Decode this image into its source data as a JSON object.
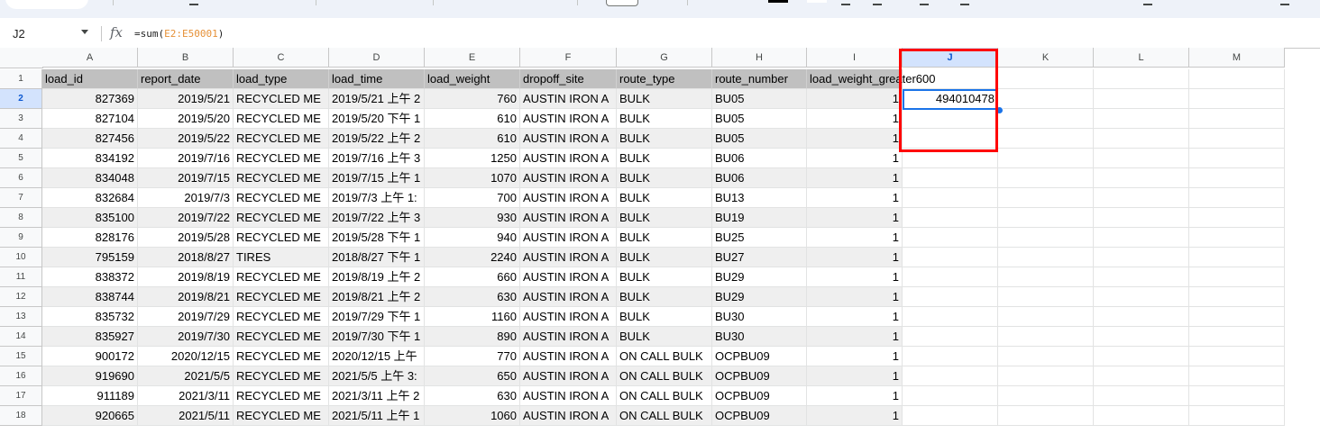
{
  "formula_bar": {
    "name_box": "J2",
    "fx_icon": "fx",
    "formula_prefix": "=sum(",
    "formula_range": "E2:E50001",
    "formula_suffix": ")"
  },
  "columns": [
    "A",
    "B",
    "C",
    "D",
    "E",
    "F",
    "G",
    "H",
    "I",
    "J",
    "K",
    "L",
    "M"
  ],
  "selected_column": "J",
  "header_row": {
    "row_number": "1",
    "cells": [
      "load_id",
      "report_date",
      "load_type",
      "load_time",
      "load_weight",
      "dropoff_site",
      "route_type",
      "route_number",
      "load_weight_greater600",
      ""
    ]
  },
  "rows": [
    {
      "row_number": "2",
      "cells": [
        "827369",
        "2019/5/21",
        "RECYCLED ME",
        "2019/5/21 上午 2",
        "760",
        "AUSTIN IRON A",
        "BULK",
        "BU05",
        "1",
        "494010478"
      ]
    },
    {
      "row_number": "3",
      "cells": [
        "827104",
        "2019/5/20",
        "RECYCLED ME",
        "2019/5/20 下午 1",
        "610",
        "AUSTIN IRON A",
        "BULK",
        "BU05",
        "1",
        ""
      ]
    },
    {
      "row_number": "4",
      "cells": [
        "827456",
        "2019/5/22",
        "RECYCLED ME",
        "2019/5/22 上午 2",
        "610",
        "AUSTIN IRON A",
        "BULK",
        "BU05",
        "1",
        ""
      ]
    },
    {
      "row_number": "5",
      "cells": [
        "834192",
        "2019/7/16",
        "RECYCLED ME",
        "2019/7/16 上午 3",
        "1250",
        "AUSTIN IRON A",
        "BULK",
        "BU06",
        "1",
        ""
      ]
    },
    {
      "row_number": "6",
      "cells": [
        "834048",
        "2019/7/15",
        "RECYCLED ME",
        "2019/7/15 上午 1",
        "1070",
        "AUSTIN IRON A",
        "BULK",
        "BU06",
        "1",
        ""
      ]
    },
    {
      "row_number": "7",
      "cells": [
        "832684",
        "2019/7/3",
        "RECYCLED ME",
        "2019/7/3 上午 1:",
        "700",
        "AUSTIN IRON A",
        "BULK",
        "BU13",
        "1",
        ""
      ]
    },
    {
      "row_number": "8",
      "cells": [
        "835100",
        "2019/7/22",
        "RECYCLED ME",
        "2019/7/22 上午 3",
        "930",
        "AUSTIN IRON A",
        "BULK",
        "BU19",
        "1",
        ""
      ]
    },
    {
      "row_number": "9",
      "cells": [
        "828176",
        "2019/5/28",
        "RECYCLED ME",
        "2019/5/28 下午 1",
        "940",
        "AUSTIN IRON A",
        "BULK",
        "BU25",
        "1",
        ""
      ]
    },
    {
      "row_number": "10",
      "cells": [
        "795159",
        "2018/8/27",
        "TIRES",
        "2018/8/27 下午 1",
        "2240",
        "AUSTIN IRON A",
        "BULK",
        "BU27",
        "1",
        ""
      ]
    },
    {
      "row_number": "11",
      "cells": [
        "838372",
        "2019/8/19",
        "RECYCLED ME",
        "2019/8/19 上午 2",
        "660",
        "AUSTIN IRON A",
        "BULK",
        "BU29",
        "1",
        ""
      ]
    },
    {
      "row_number": "12",
      "cells": [
        "838744",
        "2019/8/21",
        "RECYCLED ME",
        "2019/8/21 上午 2",
        "630",
        "AUSTIN IRON A",
        "BULK",
        "BU29",
        "1",
        ""
      ]
    },
    {
      "row_number": "13",
      "cells": [
        "835732",
        "2019/7/29",
        "RECYCLED ME",
        "2019/7/29 下午 1",
        "1160",
        "AUSTIN IRON A",
        "BULK",
        "BU30",
        "1",
        ""
      ]
    },
    {
      "row_number": "14",
      "cells": [
        "835927",
        "2019/7/30",
        "RECYCLED ME",
        "2019/7/30 下午 1",
        "890",
        "AUSTIN IRON A",
        "BULK",
        "BU30",
        "1",
        ""
      ]
    },
    {
      "row_number": "15",
      "cells": [
        "900172",
        "2020/12/15",
        "RECYCLED ME",
        "2020/12/15 上午",
        "770",
        "AUSTIN IRON A",
        "ON CALL BULK",
        "OCPBU09",
        "1",
        ""
      ]
    },
    {
      "row_number": "16",
      "cells": [
        "919690",
        "2021/5/5",
        "RECYCLED ME",
        "2021/5/5 上午 3:",
        "650",
        "AUSTIN IRON A",
        "ON CALL BULK",
        "OCPBU09",
        "1",
        ""
      ]
    },
    {
      "row_number": "17",
      "cells": [
        "911189",
        "2021/3/11",
        "RECYCLED ME",
        "2021/3/11 上午 2",
        "630",
        "AUSTIN IRON A",
        "ON CALL BULK",
        "OCPBU09",
        "1",
        ""
      ]
    },
    {
      "row_number": "18",
      "cells": [
        "920665",
        "2021/5/11",
        "RECYCLED ME",
        "2021/5/11 上午 1",
        "1060",
        "AUSTIN IRON A",
        "ON CALL BULK",
        "OCPBU09",
        "1",
        ""
      ]
    }
  ],
  "colors": {
    "accent": "#1a73e8",
    "highlight_box": "#ff0000",
    "header_fill": "#c0c0c0",
    "alt_row_fill": "#efefef",
    "selected_header": "#d3e3fd"
  }
}
